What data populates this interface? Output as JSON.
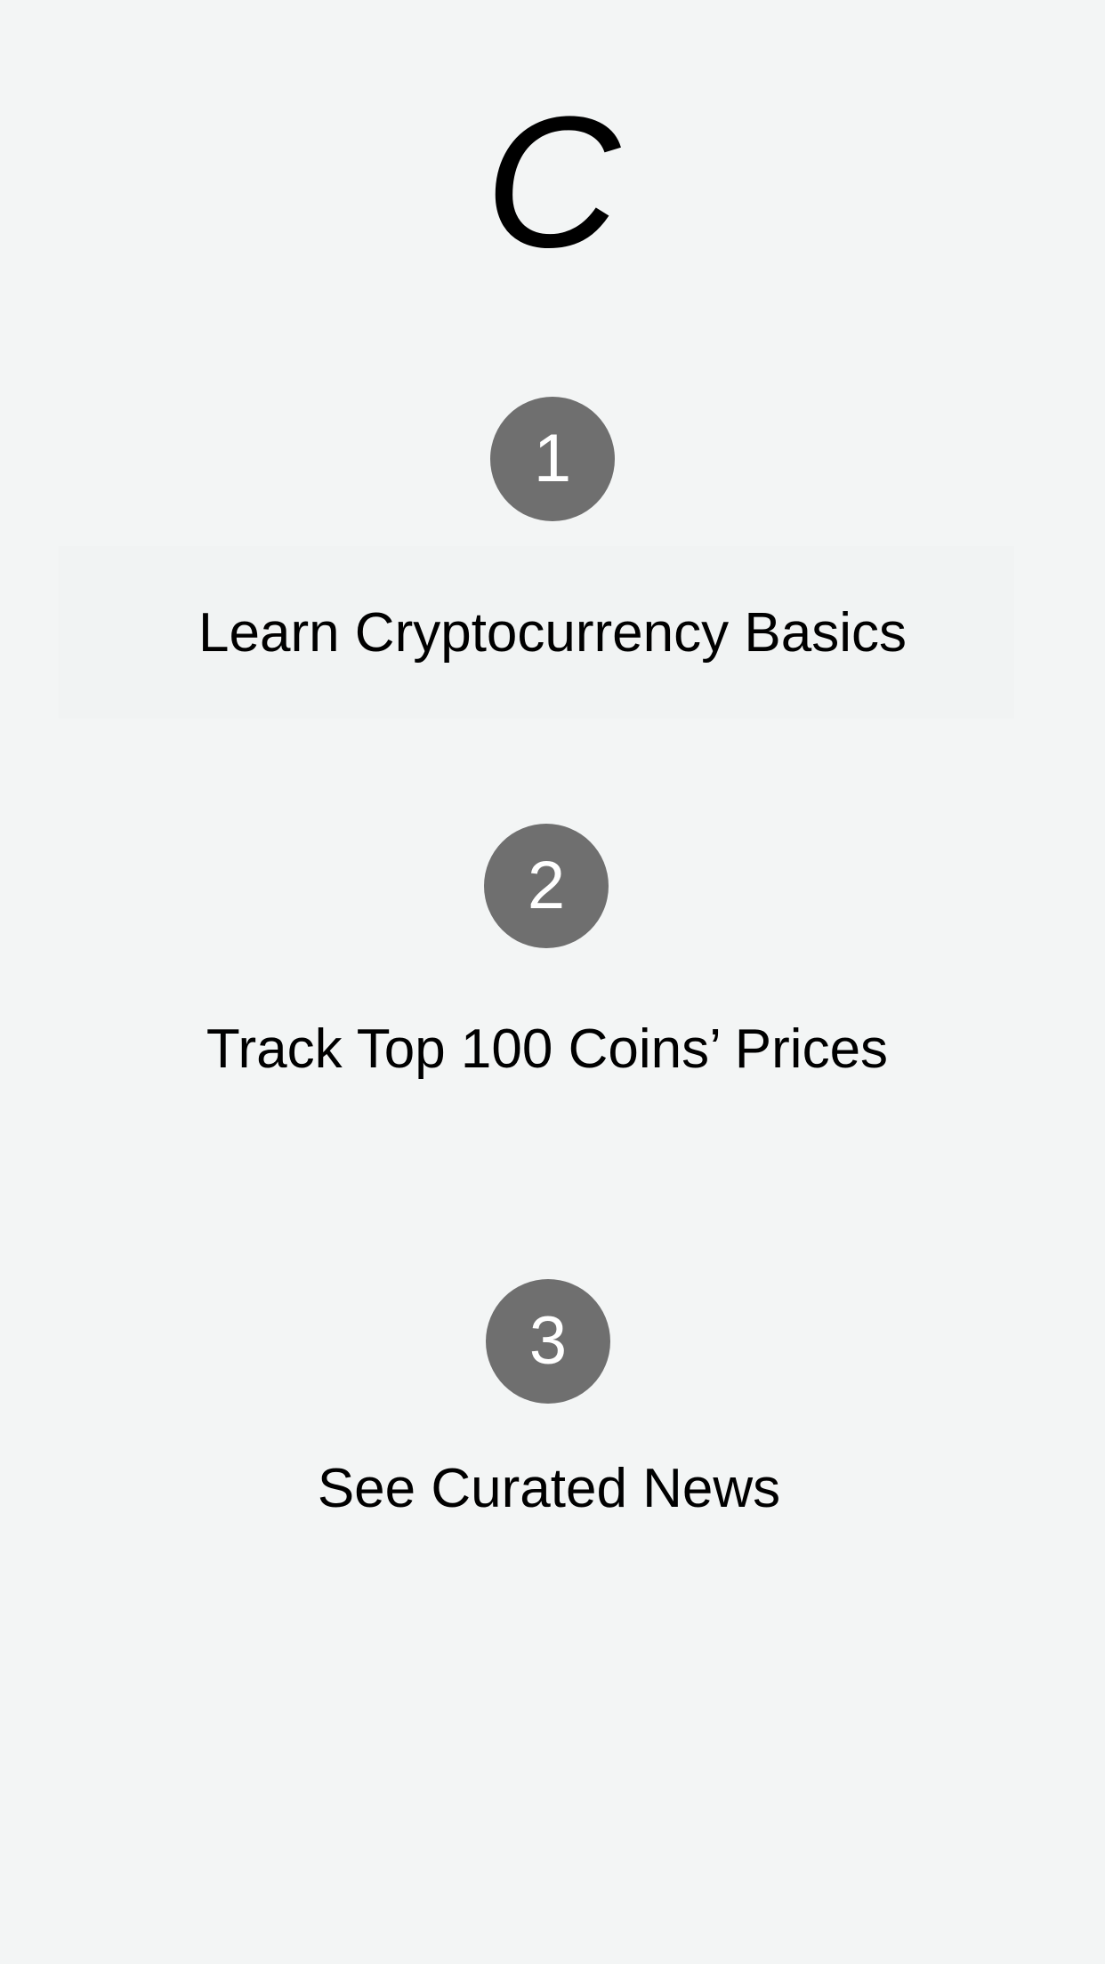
{
  "app": {
    "logo_letter": "C"
  },
  "steps": [
    {
      "number": "1",
      "label": "Learn Cryptocurrency Basics"
    },
    {
      "number": "2",
      "label": "Track Top 100 Coins’ Prices"
    },
    {
      "number": "3",
      "label": "See Curated News"
    }
  ],
  "colors": {
    "background": "#f3f5f5",
    "circle": "#6f6f6f",
    "circle_text": "#ffffff",
    "text": "#000000"
  }
}
